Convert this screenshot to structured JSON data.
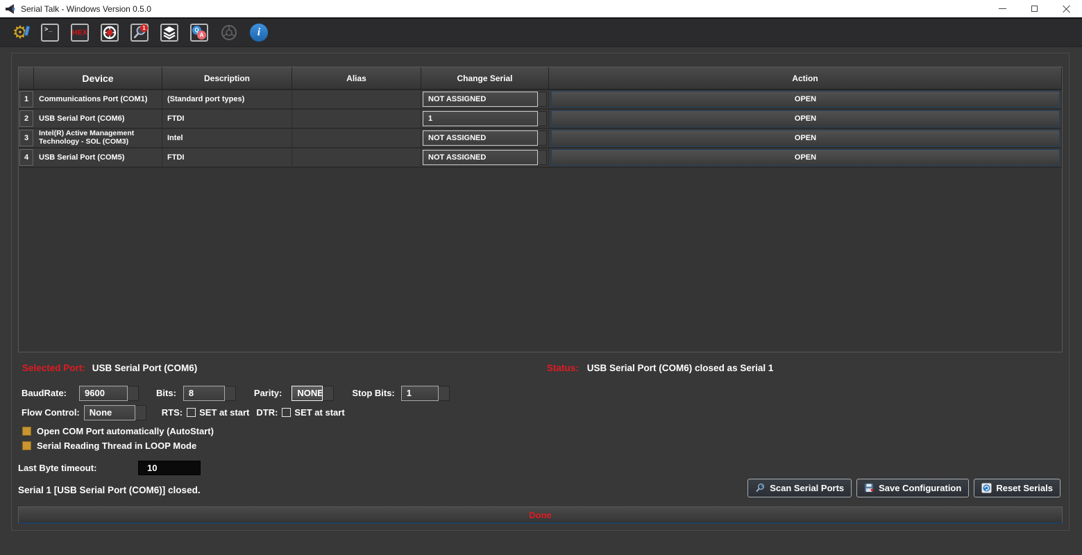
{
  "window": {
    "title": "Serial Talk - Windows Version 0.5.0"
  },
  "toolbar": {
    "terminal_glyph": ">_",
    "hex_label": "HEX",
    "search_badge": "1",
    "qa_q": "Q",
    "qa_a": "A",
    "info_glyph": "i"
  },
  "icons": {
    "app": "serial-talk-logo",
    "toolbar": [
      "settings-gear",
      "terminal",
      "hex",
      "port-wheel",
      "search-device",
      "layers",
      "qa-chat",
      "wheel-disabled",
      "info"
    ],
    "window_controls": [
      "minimize",
      "maximize",
      "close"
    ],
    "footer_buttons": [
      "scan-magnifier",
      "save-floppy",
      "reset-circle"
    ]
  },
  "table": {
    "headers": [
      "",
      "Device",
      "Description",
      "Alias",
      "Change Serial",
      "Action"
    ],
    "rows": [
      {
        "num": "1",
        "device": "Communications Port (COM1)",
        "description": "(Standard port types)",
        "alias": "",
        "serial": "NOT ASSIGNED",
        "action": "OPEN"
      },
      {
        "num": "2",
        "device": "USB Serial Port (COM6)",
        "description": "FTDI",
        "alias": "",
        "serial": "1",
        "action": "OPEN"
      },
      {
        "num": "3",
        "device": "Intel(R) Active Management Technology - SOL (COM3)",
        "description": "Intel",
        "alias": "",
        "serial": "NOT ASSIGNED",
        "action": "OPEN"
      },
      {
        "num": "4",
        "device": "USB Serial Port (COM5)",
        "description": "FTDI",
        "alias": "",
        "serial": "NOT ASSIGNED",
        "action": "OPEN"
      }
    ]
  },
  "selected_port": {
    "label": "Selected Port:",
    "value": "USB Serial Port (COM6)"
  },
  "status": {
    "label": "Status:",
    "value": "USB Serial Port (COM6) closed as Serial 1"
  },
  "params": {
    "baudrate": {
      "label": "BaudRate:",
      "value": "9600"
    },
    "bits": {
      "label": "Bits:",
      "value": "8"
    },
    "parity": {
      "label": "Parity:",
      "value": "NONE"
    },
    "stop_bits": {
      "label": "Stop Bits:",
      "value": "1"
    },
    "flow_control": {
      "label": "Flow Control:",
      "value": "None"
    },
    "rts": {
      "label": "RTS:",
      "text": "SET at start",
      "checked": false
    },
    "dtr": {
      "label": "DTR:",
      "text": "SET at start",
      "checked": false
    }
  },
  "options": [
    {
      "label": "Open COM Port automatically (AutoStart)",
      "checked": true
    },
    {
      "label": "Serial Reading Thread in LOOP Mode",
      "checked": true
    }
  ],
  "timeout": {
    "label": "Last Byte timeout:",
    "value": "10"
  },
  "message": "Serial 1 [USB Serial Port (COM6)] closed.",
  "buttons": {
    "scan": "Scan Serial Ports",
    "save": "Save Configuration",
    "reset": "Reset Serials"
  },
  "progress": {
    "text": "Done"
  },
  "colors": {
    "accent_red": "#e01b22",
    "checkbox_orange": "#c9952f",
    "button_border_navy": "#20405f",
    "info_blue": "#2176c7",
    "titlebar_bg": "#ffffff",
    "main_bg": "#383838"
  }
}
